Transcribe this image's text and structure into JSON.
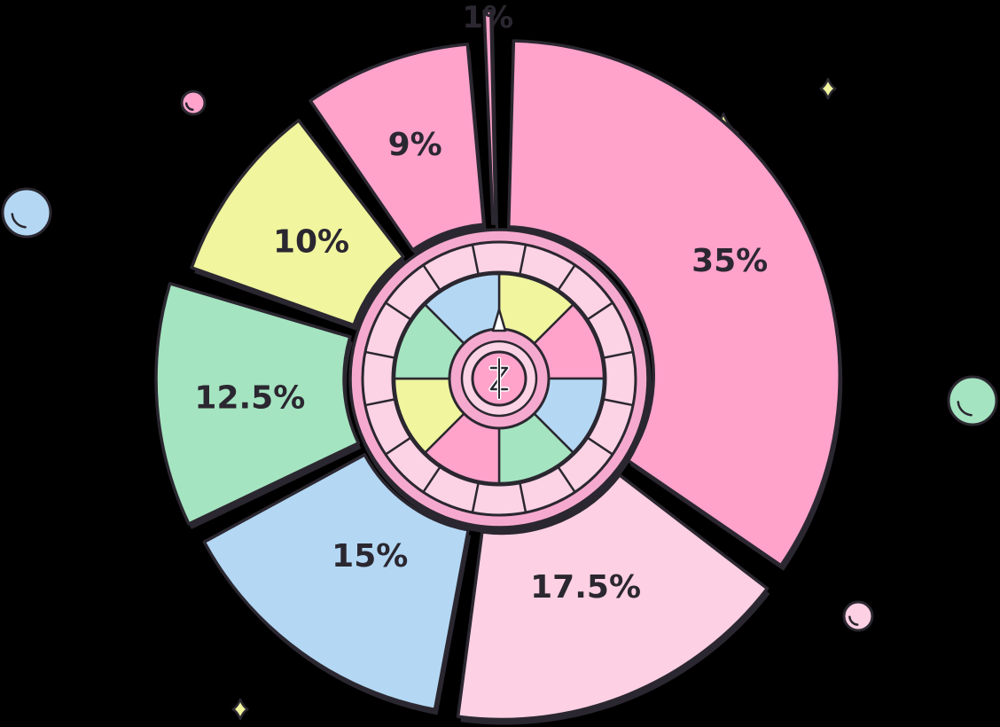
{
  "chart_data": {
    "type": "pie",
    "title": "",
    "slices": [
      {
        "label": "35%",
        "value": 35,
        "color": "#FFA3CB"
      },
      {
        "label": "17.5%",
        "value": 17.5,
        "color": "#FDD0E3"
      },
      {
        "label": "15%",
        "value": 15,
        "color": "#B4D8F4"
      },
      {
        "label": "12.5%",
        "value": 12.5,
        "color": "#A5E4C1"
      },
      {
        "label": "10%",
        "value": 10,
        "color": "#F0F59E"
      },
      {
        "label": "9%",
        "value": 9,
        "color": "#FFA3CB"
      },
      {
        "label": "1%",
        "value": 1,
        "color": "#FFA3CB"
      }
    ],
    "legend": "none",
    "center_icon": "coin-icon"
  },
  "colors": {
    "background": "#000000",
    "outline": "#2b2730",
    "wheel_pink": "#F6A9CE",
    "wheel_light": "#FBD3E5"
  },
  "decorations": {
    "bubbles": [
      "pink-bubble-icon",
      "blue-bubble-icon",
      "green-bubble-icon",
      "pink-bubble-icon"
    ],
    "sparkles": [
      "sparkle-icon",
      "sparkle-icon",
      "sparkle-icon"
    ]
  }
}
